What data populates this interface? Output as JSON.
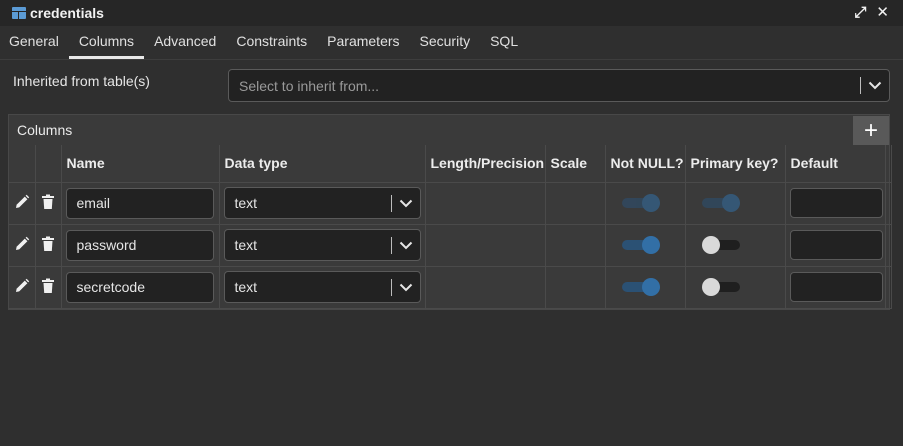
{
  "window": {
    "title": "credentials",
    "expand_icon": "expand-icon",
    "close_icon": "close-icon"
  },
  "tabs": [
    {
      "label": "General",
      "active": false
    },
    {
      "label": "Columns",
      "active": true
    },
    {
      "label": "Advanced",
      "active": false
    },
    {
      "label": "Constraints",
      "active": false
    },
    {
      "label": "Parameters",
      "active": false
    },
    {
      "label": "Security",
      "active": false
    },
    {
      "label": "SQL",
      "active": false
    }
  ],
  "inherit": {
    "label": "Inherited from table(s)",
    "placeholder": "Select to inherit from..."
  },
  "columns_panel": {
    "title": "Columns",
    "add_label": "+",
    "headers": [
      "Name",
      "Data type",
      "Length/Precision",
      "Scale",
      "Not NULL?",
      "Primary key?",
      "Default"
    ],
    "rows": [
      {
        "name": "email",
        "data_type": "text",
        "not_null": true,
        "primary_key": true,
        "primary_key_disabled": true,
        "not_null_disabled": true,
        "default": ""
      },
      {
        "name": "password",
        "data_type": "text",
        "not_null": true,
        "primary_key": false,
        "primary_key_disabled": false,
        "not_null_disabled": false,
        "default": ""
      },
      {
        "name": "secretcode",
        "data_type": "text",
        "not_null": true,
        "primary_key": false,
        "primary_key_disabled": false,
        "not_null_disabled": false,
        "default": ""
      }
    ]
  },
  "colors": {
    "toggle_on": "#326fa6",
    "toggle_track_on": "#2b5174",
    "background": "#2f2f2f"
  }
}
